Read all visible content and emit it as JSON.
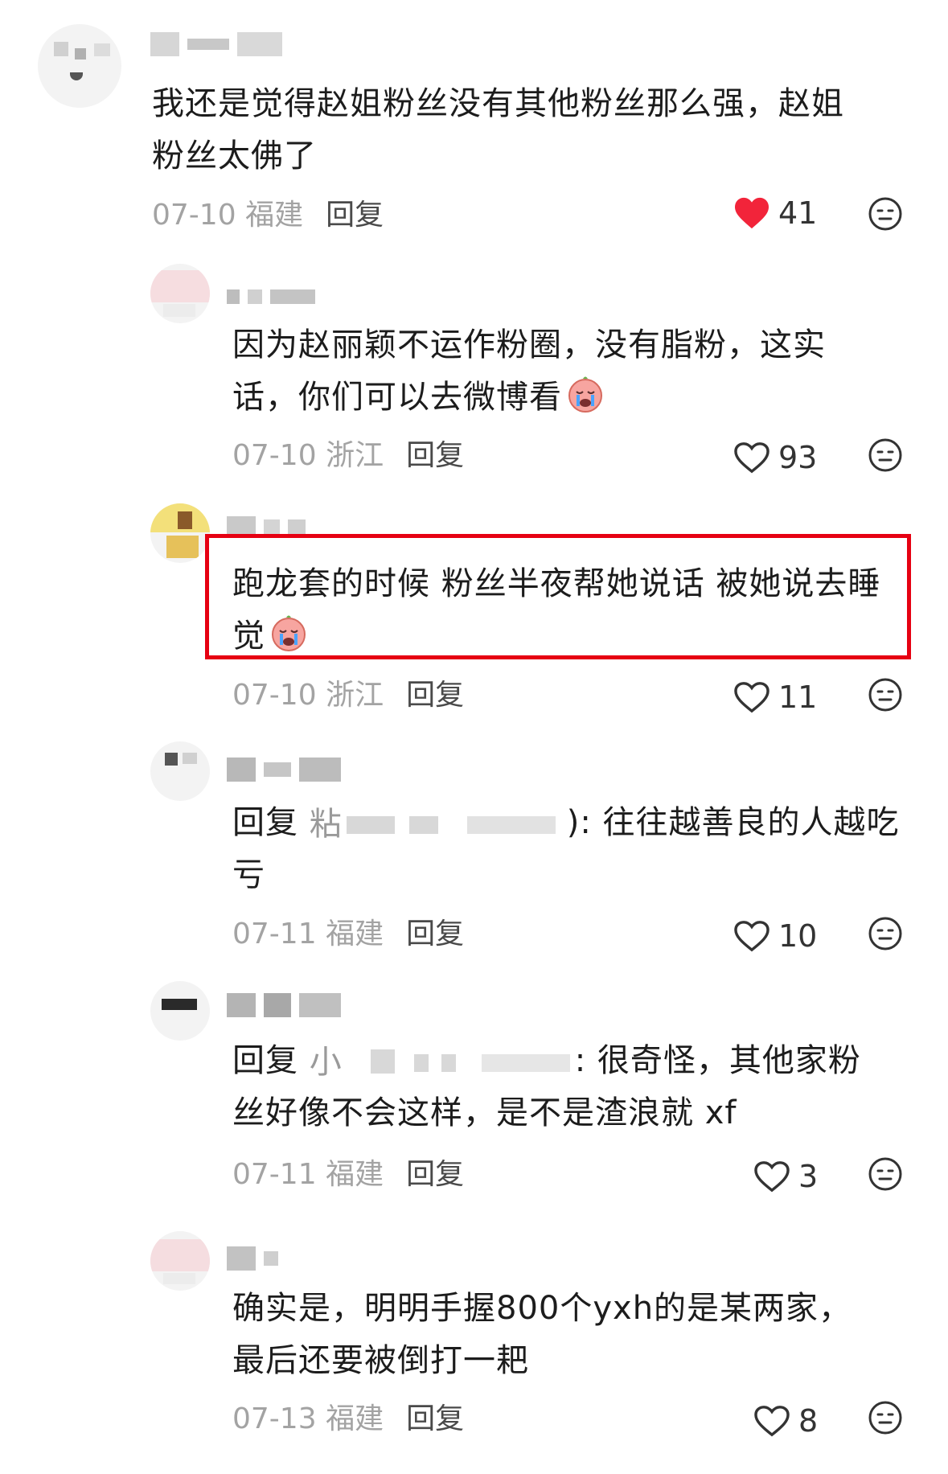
{
  "comments": [
    {
      "text_lines": [
        "我还是觉得赵姐粉丝没有其他粉丝那么强，赵姐",
        "粉丝太佛了"
      ],
      "date": "07-10",
      "location": "福建",
      "reply_label": "回复",
      "likes": "41",
      "liked": true
    },
    {
      "text_lines": [
        "因为赵丽颖不运作粉圈，没有脂粉，这实",
        "话，你们可以去微博看"
      ],
      "date": "07-10",
      "location": "浙江",
      "reply_label": "回复",
      "likes": "93",
      "liked": false
    },
    {
      "text_lines": [
        "跑龙套的时候 粉丝半夜帮她说话 被她说去睡",
        "觉"
      ],
      "date": "07-10",
      "location": "浙江",
      "reply_label": "回复",
      "likes": "11",
      "liked": false,
      "highlighted": true
    },
    {
      "reply_prefix": "回复",
      "mention_visible": "粘",
      "text_after": "): 往往越善良的人越吃",
      "text_line2": "亏",
      "date": "07-11",
      "location": "福建",
      "reply_label": "回复",
      "likes": "10",
      "liked": false
    },
    {
      "reply_prefix": "回复",
      "mention_visible": "小",
      "text_after": ": 很奇怪，其他家粉",
      "text_line2": "丝好像不会这样，是不是渣浪就 xf",
      "date": "07-11",
      "location": "福建",
      "reply_label": "回复",
      "likes": "3",
      "liked": false
    },
    {
      "text_lines": [
        "确实是，明明手握800个yxh的是某两家，",
        "最后还要被倒打一耙"
      ],
      "date": "07-13",
      "location": "福建",
      "reply_label": "回复",
      "likes": "8",
      "liked": false
    }
  ],
  "colors": {
    "liked_heart": "#f2243a",
    "highlight_border": "#e60012",
    "meta_text": "#a3a3a3"
  },
  "icons": {
    "like": "heart-icon",
    "dislike": "neutral-face-icon",
    "emoji": "crying-face-emoji"
  }
}
